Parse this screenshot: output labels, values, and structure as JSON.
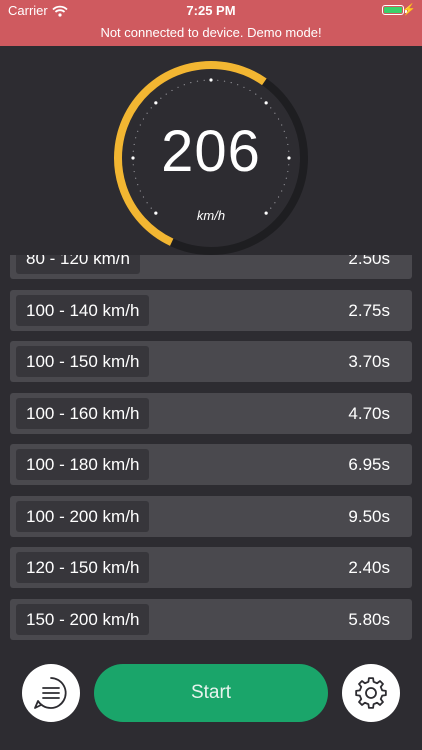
{
  "status": {
    "carrier": "Carrier",
    "time": "7:25 PM",
    "colors": {
      "bar": "#cf5a5f",
      "battery": "#3ad06a"
    }
  },
  "banner": {
    "text": "Not connected to device. Demo mode!"
  },
  "gauge": {
    "speed": "206",
    "unit": "km/h",
    "fraction": 0.55,
    "colors": {
      "progress": "#f2b632",
      "track": "#1e1e21"
    }
  },
  "intervals": [
    {
      "label": "80 - 120 km/h",
      "time": "2.50s"
    },
    {
      "label": "100 - 140 km/h",
      "time": "2.75s"
    },
    {
      "label": "100 - 150 km/h",
      "time": "3.70s"
    },
    {
      "label": "100 - 160 km/h",
      "time": "4.70s"
    },
    {
      "label": "100 - 180 km/h",
      "time": "6.95s"
    },
    {
      "label": "100 - 200 km/h",
      "time": "9.50s"
    },
    {
      "label": "120 - 150 km/h",
      "time": "2.40s"
    },
    {
      "label": "150 - 200 km/h",
      "time": "5.80s"
    }
  ],
  "bottom": {
    "start_label": "Start",
    "menu_icon": "list-menu-icon",
    "settings_icon": "gear-icon",
    "start_color": "#1aa56a"
  }
}
